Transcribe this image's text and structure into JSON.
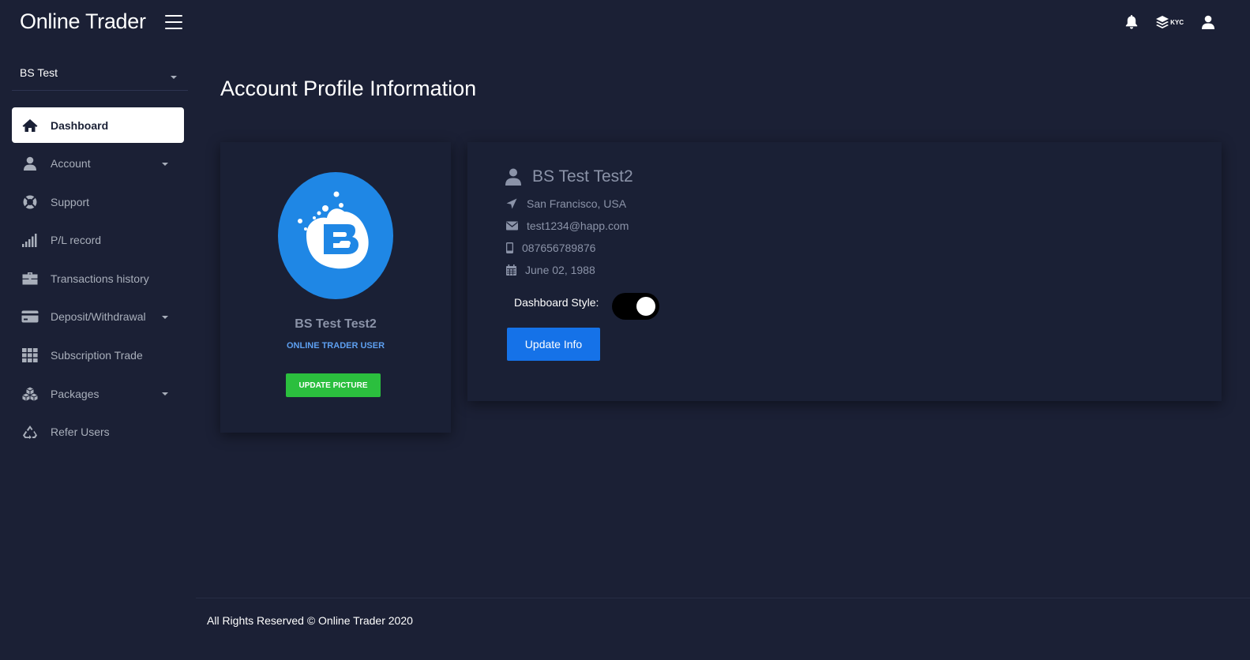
{
  "app": {
    "title": "Online Trader"
  },
  "topbar": {
    "icons": [
      "menu-icon",
      "bell-icon",
      "layers-icon",
      "user-icon"
    ],
    "kyc_label": "KYC"
  },
  "sidebar": {
    "user_select": "BS Test",
    "items": [
      {
        "label": "Dashboard",
        "icon": "home-icon",
        "active": true,
        "has_caret": false
      },
      {
        "label": "Account",
        "icon": "user-icon",
        "active": false,
        "has_caret": true
      },
      {
        "label": "Support",
        "icon": "lifebuoy-icon",
        "active": false,
        "has_caret": false
      },
      {
        "label": "P/L record",
        "icon": "signal-icon",
        "active": false,
        "has_caret": false
      },
      {
        "label": "Transactions history",
        "icon": "briefcase-icon",
        "active": false,
        "has_caret": false
      },
      {
        "label": "Deposit/Withdrawal",
        "icon": "credit-card-icon",
        "active": false,
        "has_caret": true
      },
      {
        "label": "Subscription Trade",
        "icon": "grid-icon",
        "active": false,
        "has_caret": false
      },
      {
        "label": "Packages",
        "icon": "cubes-icon",
        "active": false,
        "has_caret": true
      },
      {
        "label": "Refer Users",
        "icon": "recycle-icon",
        "active": false,
        "has_caret": false
      }
    ]
  },
  "main": {
    "page_title": "Account Profile Information",
    "profile_card": {
      "name": "BS Test Test2",
      "role": "ONLINE TRADER USER",
      "update_picture_label": "UPDATE PICTURE"
    },
    "info_card": {
      "name": "BS Test Test2",
      "location": "San Francisco, USA",
      "email": "test1234@happ.com",
      "phone": "087656789876",
      "dob": "June 02, 1988",
      "dashboard_style_label": "Dashboard Style:",
      "dashboard_style_on": true,
      "update_info_label": "Update Info"
    }
  },
  "footer": {
    "text": "All Rights Reserved © Online Trader 2020"
  },
  "colors": {
    "background": "#1b2035",
    "card": "#1a2035",
    "primary_button": "#1572e8",
    "success_button": "#2bbf3e",
    "accent_text": "#5d9ff0",
    "muted_text": "#8b93a8",
    "avatar_blue": "#1f87e5"
  }
}
